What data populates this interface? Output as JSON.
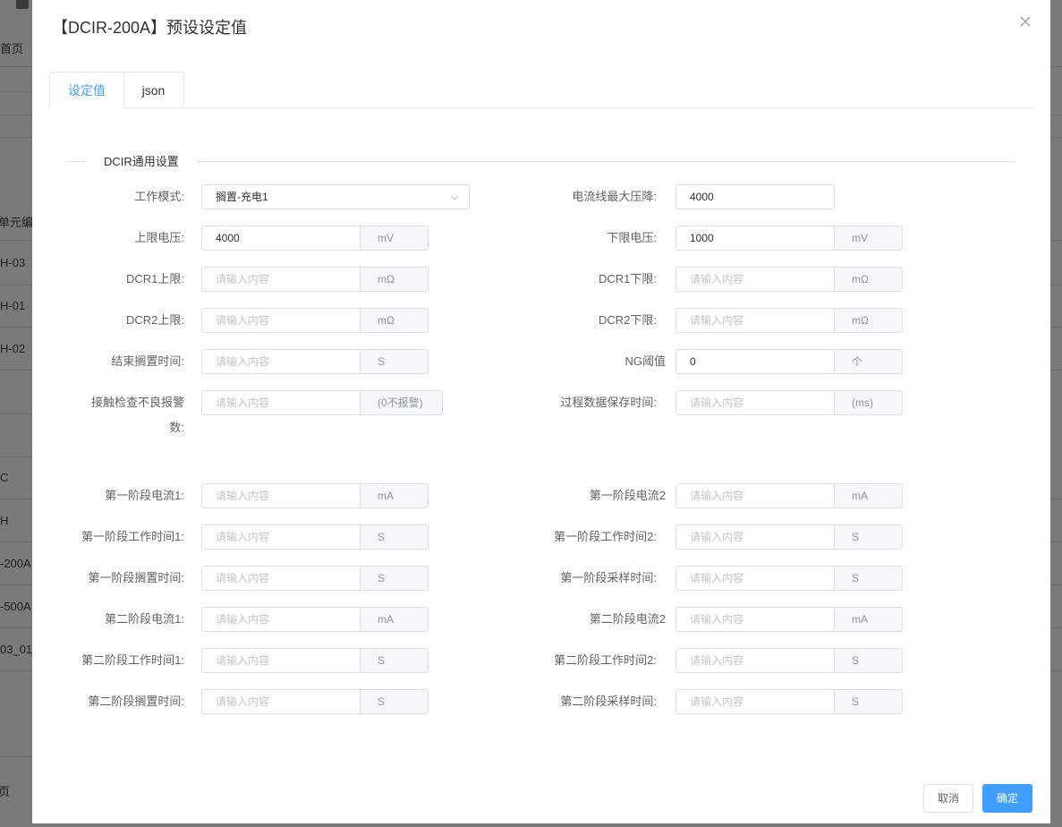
{
  "background": {
    "left_texts": [
      "置首页",
      "单元编",
      "H-03",
      "H-01",
      "H-02",
      "C",
      "H",
      "-200A",
      "-500A",
      "03_01",
      "页"
    ]
  },
  "dialog": {
    "title": "【DCIR-200A】预设设定值",
    "tabs": [
      {
        "label": "设定值",
        "active": true
      },
      {
        "label": "json",
        "active": false
      }
    ],
    "section_title": "DCIR通用设置",
    "rows": [
      {
        "left": {
          "label": "工作模式:",
          "type": "select",
          "value": "搁置-充电1"
        },
        "right": {
          "label": "电流线最大压降:",
          "type": "input",
          "value": "4000"
        }
      },
      {
        "left": {
          "label": "上限电压:",
          "type": "input-unit",
          "value": "4000",
          "unit": "mV"
        },
        "right": {
          "label": "下限电压:",
          "type": "input-unit",
          "value": "1000",
          "unit": "mV"
        }
      },
      {
        "left": {
          "label": "DCR1上限:",
          "type": "input-unit",
          "placeholder": "请输入内容",
          "unit": "mΩ"
        },
        "right": {
          "label": "DCR1下限:",
          "type": "input-unit",
          "placeholder": "请输入内容",
          "unit": "mΩ"
        }
      },
      {
        "left": {
          "label": "DCR2上限:",
          "type": "input-unit",
          "placeholder": "请输入内容",
          "unit": "mΩ"
        },
        "right": {
          "label": "DCR2下限:",
          "type": "input-unit",
          "placeholder": "请输入内容",
          "unit": "mΩ"
        }
      },
      {
        "left": {
          "label": "结束搁置时间:",
          "type": "input-unit",
          "placeholder": "请输入内容",
          "unit": "S"
        },
        "right": {
          "label": "NG阈值",
          "type": "input-unit",
          "value": "0",
          "unit": "个"
        }
      },
      {
        "left": {
          "label_line1": "接触检查不良报警",
          "label_line2": "数:",
          "type": "input-unit",
          "placeholder": "请输入内容",
          "unit": "(0不报警)"
        },
        "right": {
          "label": "过程数据保存时间:",
          "type": "input-unit",
          "placeholder": "请输入内容",
          "unit": "(ms)"
        }
      },
      {
        "left": {
          "label": "第一阶段电流1:",
          "type": "input-unit",
          "placeholder": "请输入内容",
          "unit": "mA"
        },
        "right": {
          "label": "第一阶段电流2",
          "type": "input-unit",
          "placeholder": "请输入内容",
          "unit": "mA"
        }
      },
      {
        "left": {
          "label": "第一阶段工作时间1:",
          "type": "input-unit",
          "placeholder": "请输入内容",
          "unit": "S"
        },
        "right": {
          "label": "第一阶段工作时间2:",
          "type": "input-unit",
          "placeholder": "请输入内容",
          "unit": "S"
        }
      },
      {
        "left": {
          "label": "第一阶段搁置时间:",
          "type": "input-unit",
          "placeholder": "请输入内容",
          "unit": "S"
        },
        "right": {
          "label": "第一阶段采样时间:",
          "type": "input-unit",
          "placeholder": "请输入内容",
          "unit": "S"
        }
      },
      {
        "left": {
          "label": "第二阶段电流1:",
          "type": "input-unit",
          "placeholder": "请输入内容",
          "unit": "mA"
        },
        "right": {
          "label": "第二阶段电流2",
          "type": "input-unit",
          "placeholder": "请输入内容",
          "unit": "mA"
        }
      },
      {
        "left": {
          "label": "第二阶段工作时间1:",
          "type": "input-unit",
          "placeholder": "请输入内容",
          "unit": "S"
        },
        "right": {
          "label": "第二阶段工作时间2:",
          "type": "input-unit",
          "placeholder": "请输入内容",
          "unit": "S"
        }
      },
      {
        "left": {
          "label": "第二阶段搁置时间:",
          "type": "input-unit",
          "placeholder": "请输入内容",
          "unit": "S"
        },
        "right": {
          "label": "第二阶段采样时间:",
          "type": "input-unit",
          "placeholder": "请输入内容",
          "unit": "S"
        }
      }
    ],
    "footer": {
      "cancel_label": "取消",
      "ok_label": "确定"
    },
    "icons": {
      "close": "close-icon",
      "select_arrow": "chevron-down-icon"
    },
    "colors": {
      "accent": "#409eff",
      "overlay": "#7f7f7f"
    }
  }
}
